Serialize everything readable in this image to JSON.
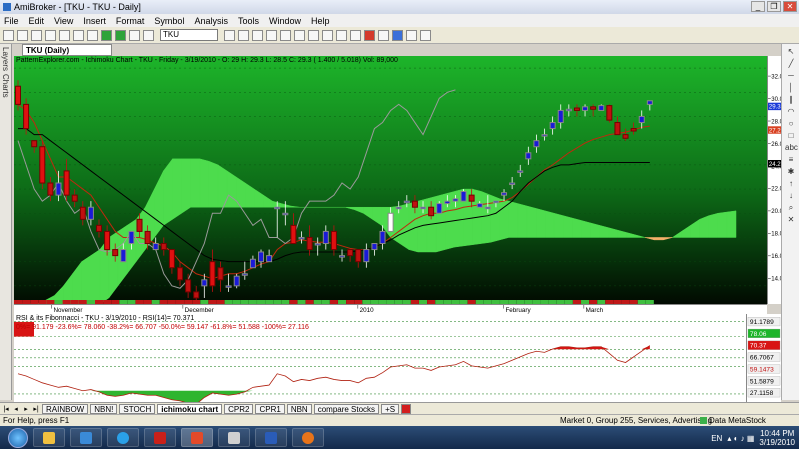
{
  "window": {
    "title": "AmiBroker - [TKU - TKU - Daily]",
    "minimize": "_",
    "restore": "❐",
    "close": "✕"
  },
  "menu": [
    "File",
    "Edit",
    "View",
    "Insert",
    "Format",
    "Symbol",
    "Analysis",
    "Tools",
    "Window",
    "Help"
  ],
  "toolbar": {
    "symbol_value": "TKU"
  },
  "doc_tab": {
    "label": "TKU (Daily)",
    "close": "✕"
  },
  "side_tabs": [
    "Layers",
    "Charts"
  ],
  "chart": {
    "header": "PatternExplorer.com - Ichimoku Chart - TKU - Friday - 3/19/2010 - O: 29 H: 29.3 L: 28.5 C: 29.3 (  1.400 /  5.018) Vol: 89,000",
    "y_ticks": [
      "32.0",
      "30.0",
      "28.0",
      "26.0",
      "24.0",
      "22.0",
      "20.0",
      "18.0",
      "16.0",
      "14.0"
    ],
    "markers": {
      "close": "29.3",
      "tenkan": "27.2",
      "kijun": "24.2"
    },
    "dates": [
      "November",
      "December",
      "2010",
      "February",
      "March"
    ]
  },
  "rsi": {
    "header": "RSI & its Fibonnacci - TKU - 3/19/2010 - RSI(14)=  70.371",
    "levels_line": "0%=  91.179  -23.6%=  78.060  -38.2%=  66.707  -50.0%=  59.147  -61.8%=  51.588  -100%=  27.116",
    "axis_labels": [
      "91.1789",
      "78.06",
      "70.37",
      "66.7067",
      "59.1473",
      "51.5879",
      "27.1158"
    ]
  },
  "sheet_tabs": [
    "RAINBOW",
    "NBN!",
    "STOCH",
    "ichimoku chart",
    "CPR2",
    "CPR1",
    "NBN",
    "compare Stocks",
    "+S"
  ],
  "status": {
    "help": "For Help, press F1",
    "market": "Market 0, Group 255, Services, Advertising",
    "source": "Data MetaStock"
  },
  "taskbar": {
    "lang": "EN",
    "time": "10:44 PM",
    "date": "3/19/2010"
  },
  "chart_data": {
    "type": "line",
    "title": "",
    "ylim": [
      12.5,
      33
    ],
    "candles": [
      [
        30.5,
        31,
        28.5,
        29
      ],
      [
        29,
        29.5,
        26.5,
        27
      ],
      [
        26,
        26,
        25,
        25.5
      ],
      [
        25.5,
        26,
        22,
        22.5
      ],
      [
        22.5,
        23,
        21,
        21.5
      ],
      [
        21.5,
        23.5,
        21,
        22.5
      ],
      [
        23.5,
        24.5,
        21,
        21.5
      ],
      [
        21.5,
        22,
        20.5,
        21
      ],
      [
        20.5,
        21,
        19,
        19.5
      ],
      [
        19.5,
        21,
        19,
        20.5
      ],
      [
        19,
        19.5,
        18,
        18.5
      ],
      [
        18.5,
        19,
        16.5,
        17
      ],
      [
        17,
        17.5,
        16,
        16.5
      ],
      [
        16,
        17.5,
        16,
        17
      ],
      [
        17.5,
        18.5,
        17,
        18.5
      ],
      [
        19.5,
        20,
        18,
        18.5
      ],
      [
        18.5,
        19,
        17,
        17.5
      ],
      [
        17,
        18,
        17,
        17.5
      ],
      [
        17.5,
        18,
        16.5,
        17
      ],
      [
        17,
        17,
        15,
        15.5
      ],
      [
        15.5,
        16,
        14,
        14.5
      ],
      [
        14.5,
        15,
        13,
        13.5
      ],
      [
        13.5,
        14,
        12.7,
        13
      ],
      [
        14,
        15,
        13,
        14.5
      ],
      [
        16,
        17,
        13.5,
        14
      ],
      [
        15.5,
        16,
        13.5,
        14.5
      ],
      [
        14,
        15,
        13.5,
        14
      ],
      [
        14,
        15,
        13.8,
        14.8
      ],
      [
        15,
        16,
        14.5,
        15
      ],
      [
        15.5,
        16.5,
        15.5,
        16.2
      ],
      [
        16,
        17,
        15.5,
        16.8
      ],
      [
        16,
        17,
        16,
        16.5
      ],
      [
        20.5,
        21,
        18,
        20.5
      ],
      [
        20,
        21,
        19,
        20
      ],
      [
        19,
        20,
        17.5,
        17.5
      ],
      [
        18,
        18.5,
        17.5,
        18
      ],
      [
        18,
        19,
        16.5,
        17
      ],
      [
        17.5,
        18,
        16.5,
        17.5
      ],
      [
        17.5,
        19,
        17,
        18.5
      ],
      [
        18.5,
        19,
        16.5,
        17
      ],
      [
        16.5,
        17,
        16,
        16.5
      ],
      [
        17,
        17,
        16,
        16.5
      ],
      [
        17,
        17,
        15.5,
        16
      ],
      [
        16,
        17.5,
        15.5,
        17
      ],
      [
        17,
        17.5,
        16.5,
        17.5
      ],
      [
        17.5,
        19,
        17,
        18.5
      ],
      [
        18.5,
        20.5,
        18.5,
        20
      ],
      [
        20.5,
        21,
        20,
        20.5
      ],
      [
        21,
        21.5,
        20.5,
        21
      ],
      [
        21,
        21.5,
        20,
        20.5
      ],
      [
        20.5,
        21,
        20,
        20.5
      ],
      [
        20.5,
        21,
        19.5,
        19.8
      ],
      [
        20,
        21,
        20,
        20.8
      ],
      [
        20.8,
        21.5,
        20.5,
        21
      ],
      [
        21,
        21.5,
        20.5,
        21.2
      ],
      [
        21,
        22,
        21,
        21.8
      ],
      [
        21.5,
        22,
        20.5,
        21
      ],
      [
        20.5,
        21,
        20.5,
        20.8
      ],
      [
        20.5,
        21.5,
        20,
        20.5
      ],
      [
        21,
        21,
        20.5,
        21
      ],
      [
        21.5,
        22,
        21,
        21.7
      ],
      [
        22.5,
        23,
        22,
        22.5
      ],
      [
        23.5,
        24,
        23,
        23.5
      ],
      [
        24.5,
        25.5,
        24,
        25
      ],
      [
        25.5,
        26.5,
        25,
        26
      ],
      [
        26.5,
        27,
        26,
        26.5
      ],
      [
        27,
        28,
        26.5,
        27.5
      ],
      [
        27.5,
        29,
        27,
        28.5
      ],
      [
        28.5,
        29,
        28,
        28.6
      ],
      [
        28.7,
        29,
        28,
        28.5
      ],
      [
        28.5,
        29,
        28,
        28.8
      ],
      [
        28.8,
        29,
        28,
        28.6
      ],
      [
        28.5,
        29,
        28.5,
        28.9
      ],
      [
        28.9,
        29,
        27.5,
        27.7
      ],
      [
        27.5,
        28,
        26.5,
        26.5
      ],
      [
        26.5,
        27,
        26,
        26.2
      ],
      [
        27,
        27.5,
        26.5,
        26.8
      ],
      [
        27.5,
        28.5,
        27,
        28
      ],
      [
        29,
        29.3,
        28.5,
        29.3
      ]
    ],
    "series": [
      {
        "name": "Tenkan",
        "values": [
          29,
          28.5,
          27.5,
          26,
          24.5,
          23,
          23,
          22.5,
          22,
          21.5,
          20.5,
          19.5,
          18.5,
          18,
          18,
          18,
          17.8,
          17.5,
          17.3,
          16.8,
          16,
          15.5,
          15,
          14.8,
          14.6,
          14.8,
          15,
          15,
          15.2,
          15.5,
          15.8,
          16,
          17,
          17.5,
          17.6,
          17.8,
          17.7,
          17.6,
          17.6,
          17.5,
          17.3,
          17.1,
          17,
          17,
          17.2,
          17.5,
          18,
          18.5,
          19,
          19.5,
          19.8,
          20,
          20,
          20.2,
          20.3,
          20.5,
          20.6,
          20.7,
          20.8,
          20.9,
          21,
          21.3,
          21.8,
          22.4,
          23,
          23.6,
          24,
          24.5,
          25,
          25.4,
          25.8,
          26.1,
          26.3,
          26.5,
          26.6,
          26.7,
          26.9,
          27.1,
          27.2
        ]
      },
      {
        "name": "Kijun",
        "values": [
          27,
          27,
          26.5,
          26.5,
          26,
          25.5,
          25,
          24.5,
          24,
          23.5,
          23,
          22.5,
          22,
          21.5,
          21,
          20.5,
          20,
          19.5,
          19,
          18.5,
          18,
          17.5,
          17,
          16.5,
          16.2,
          16.1,
          16,
          16,
          16,
          16,
          16,
          16,
          16.2,
          16.5,
          16.7,
          16.8,
          16.8,
          16.8,
          16.8,
          16.8,
          16.8,
          16.8,
          16.9,
          17,
          17.2,
          17.5,
          17.8,
          18.2,
          18.5,
          18.8,
          19,
          19.1,
          19.2,
          19.3,
          19.4,
          19.5,
          19.6,
          19.7,
          19.8,
          20,
          20.5,
          21,
          21.8,
          22.5,
          23,
          23.5,
          23.8,
          24,
          24,
          24.1,
          24.2,
          24.2,
          24.2,
          24.2,
          24.2,
          24.2,
          24.2,
          24.2,
          24.2
        ]
      },
      {
        "name": "Chikou",
        "values": [
          26,
          24,
          22,
          21,
          21.5,
          22.5,
          21,
          20,
          20.5,
          18.5,
          17,
          16.8,
          17,
          17.5,
          18.5,
          17.5,
          17.5,
          17,
          15,
          14,
          13.8,
          14.5,
          16,
          17.5,
          20,
          20,
          21.5,
          21,
          20,
          19,
          19.5,
          18,
          18,
          17.5,
          18,
          20,
          21,
          21,
          21,
          21.5,
          22.5,
          22,
          23,
          25,
          27,
          27.5,
          28.5,
          29,
          28.5,
          27.5,
          26.5,
          28,
          29.5,
          30,
          30.2
        ]
      },
      {
        "name": "RSI",
        "values": [
          45,
          43,
          40,
          37,
          35,
          33,
          34,
          32,
          30,
          31,
          29,
          26,
          25,
          26,
          28,
          27,
          26,
          26,
          24,
          22,
          21,
          19,
          18,
          24,
          28,
          27,
          26,
          27,
          29,
          33,
          34,
          35,
          45,
          43,
          38,
          40,
          39,
          41,
          42,
          40,
          39,
          39,
          37,
          41,
          42,
          46,
          51,
          52,
          53,
          50,
          50,
          48,
          51,
          52,
          53,
          56,
          52,
          51,
          50,
          52,
          54,
          57,
          60,
          63,
          65,
          64,
          67,
          69,
          69,
          68,
          68,
          69,
          69,
          63,
          57,
          55,
          60,
          65,
          70
        ]
      }
    ],
    "cloud": {
      "span_a": [
        12.5,
        12.5,
        12.5,
        12.8,
        13.2,
        14,
        15,
        16,
        16.5,
        17,
        18,
        18.5,
        19,
        19.5,
        20.5,
        22,
        23.5,
        24.5,
        24.5,
        24.5,
        24.5,
        24.3,
        24,
        23.5,
        23,
        22.5,
        22,
        21.5,
        21,
        20.8,
        20.6,
        20.5,
        20.5,
        20.5,
        20.5,
        20.5,
        20.5,
        20.5,
        20.5,
        20.5,
        20.5,
        20.5,
        20.6,
        20.8,
        21,
        21.2,
        21.4,
        21.6,
        21.8,
        22,
        22,
        21.8,
        21.5,
        21.2,
        21,
        20.8,
        20.6,
        20.4,
        20.2,
        20,
        19.8,
        19.6,
        19.4,
        19.2,
        19,
        18.8,
        18.6,
        18.4,
        18.2,
        18,
        17.8,
        17.8,
        18,
        18.5,
        19,
        19.5,
        19.8,
        20,
        20.1,
        20.2
      ],
      "span_b": [
        12.5,
        12.5,
        12.5,
        12.5,
        12.5,
        12.5,
        12.5,
        12.5,
        12.5,
        12.5,
        13,
        14,
        15,
        16,
        17,
        18,
        19,
        19.5,
        20,
        20.5,
        20.5,
        20.5,
        20.5,
        20.5,
        20.5,
        20.5,
        20.5,
        20.5,
        20.5,
        20.5,
        20.5,
        20.5,
        20.5,
        20.5,
        20.5,
        20.5,
        20.5,
        20.3,
        20,
        19.5,
        19,
        18,
        17.5,
        17,
        16.8,
        16.8,
        16.8,
        17,
        17.2,
        17.3,
        17.4,
        17.5,
        17.6,
        17.8,
        18,
        18,
        18,
        18,
        18,
        18,
        18,
        18,
        18,
        18,
        18,
        18,
        18,
        18,
        18,
        18,
        18,
        18,
        18,
        18,
        18,
        18,
        18,
        18,
        18,
        18
      ]
    },
    "rsi_levels": [
      91.179,
      78.06,
      66.707,
      59.147,
      51.588,
      27.116
    ]
  }
}
